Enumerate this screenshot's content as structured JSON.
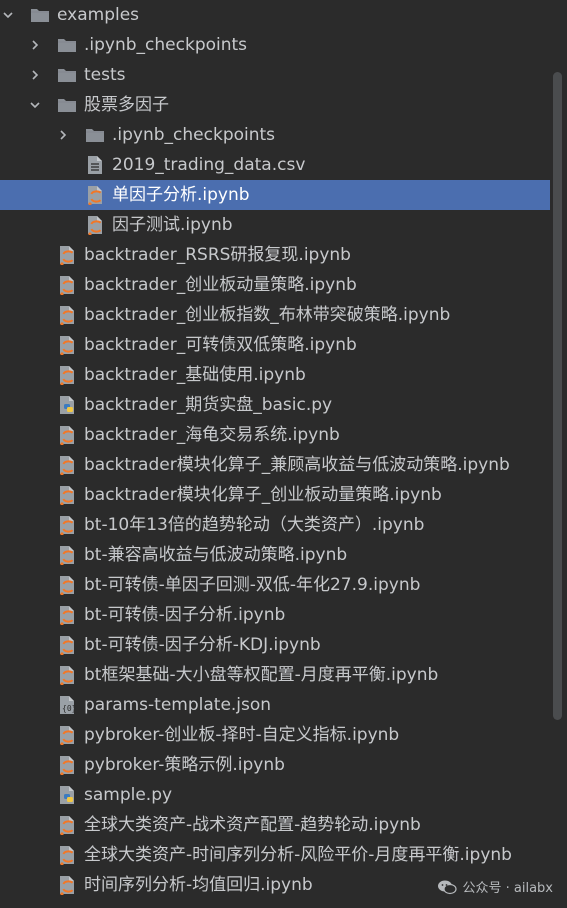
{
  "tree": {
    "items": [
      {
        "label": "examples",
        "type": "folder",
        "expanded": true,
        "depth": 0
      },
      {
        "label": ".ipynb_checkpoints",
        "type": "folder",
        "expanded": false,
        "depth": 1
      },
      {
        "label": "tests",
        "type": "folder",
        "expanded": false,
        "depth": 1
      },
      {
        "label": "股票多因子",
        "type": "folder",
        "expanded": true,
        "depth": 1
      },
      {
        "label": ".ipynb_checkpoints",
        "type": "folder",
        "expanded": false,
        "depth": 2
      },
      {
        "label": "2019_trading_data.csv",
        "type": "csv",
        "depth": 2
      },
      {
        "label": "单因子分析.ipynb",
        "type": "notebook",
        "depth": 2,
        "selected": true
      },
      {
        "label": "因子测试.ipynb",
        "type": "notebook",
        "depth": 2
      },
      {
        "label": "backtrader_RSRS研报复现.ipynb",
        "type": "notebook",
        "depth": 1
      },
      {
        "label": "backtrader_创业板动量策略.ipynb",
        "type": "notebook",
        "depth": 1
      },
      {
        "label": "backtrader_创业板指数_布林带突破策略.ipynb",
        "type": "notebook",
        "depth": 1
      },
      {
        "label": "backtrader_可转债双低策略.ipynb",
        "type": "notebook",
        "depth": 1
      },
      {
        "label": "backtrader_基础使用.ipynb",
        "type": "notebook",
        "depth": 1
      },
      {
        "label": "backtrader_期货实盘_basic.py",
        "type": "python",
        "depth": 1
      },
      {
        "label": "backtrader_海龟交易系统.ipynb",
        "type": "notebook",
        "depth": 1
      },
      {
        "label": "backtrader模块化算子_兼顾高收益与低波动策略.ipynb",
        "type": "notebook",
        "depth": 1
      },
      {
        "label": "backtrader模块化算子_创业板动量策略.ipynb",
        "type": "notebook",
        "depth": 1
      },
      {
        "label": "bt-10年13倍的趋势轮动（大类资产）.ipynb",
        "type": "notebook",
        "depth": 1
      },
      {
        "label": "bt-兼容高收益与低波动策略.ipynb",
        "type": "notebook",
        "depth": 1
      },
      {
        "label": "bt-可转债-单因子回测-双低-年化27.9.ipynb",
        "type": "notebook",
        "depth": 1
      },
      {
        "label": "bt-可转债-因子分析.ipynb",
        "type": "notebook",
        "depth": 1
      },
      {
        "label": "bt-可转债-因子分析-KDJ.ipynb",
        "type": "notebook",
        "depth": 1
      },
      {
        "label": "bt框架基础-大小盘等权配置-月度再平衡.ipynb",
        "type": "notebook",
        "depth": 1
      },
      {
        "label": "params-template.json",
        "type": "json",
        "depth": 1
      },
      {
        "label": "pybroker-创业板-择时-自定义指标.ipynb",
        "type": "notebook",
        "depth": 1
      },
      {
        "label": "pybroker-策略示例.ipynb",
        "type": "notebook",
        "depth": 1
      },
      {
        "label": "sample.py",
        "type": "python",
        "depth": 1
      },
      {
        "label": "全球大类资产-战术资产配置-趋势轮动.ipynb",
        "type": "notebook",
        "depth": 1
      },
      {
        "label": "全球大类资产-时间序列分析-风险平价-月度再平衡.ipynb",
        "type": "notebook",
        "depth": 1
      },
      {
        "label": "时间序列分析-均值回归.ipynb",
        "type": "notebook",
        "depth": 1
      }
    ]
  },
  "watermark": {
    "text": "公众号 · ailabx"
  },
  "colors": {
    "background": "#2b2b2b",
    "selection": "#4b6eaf",
    "folder": "#8a8f96",
    "notebook_orange": "#f37726"
  }
}
